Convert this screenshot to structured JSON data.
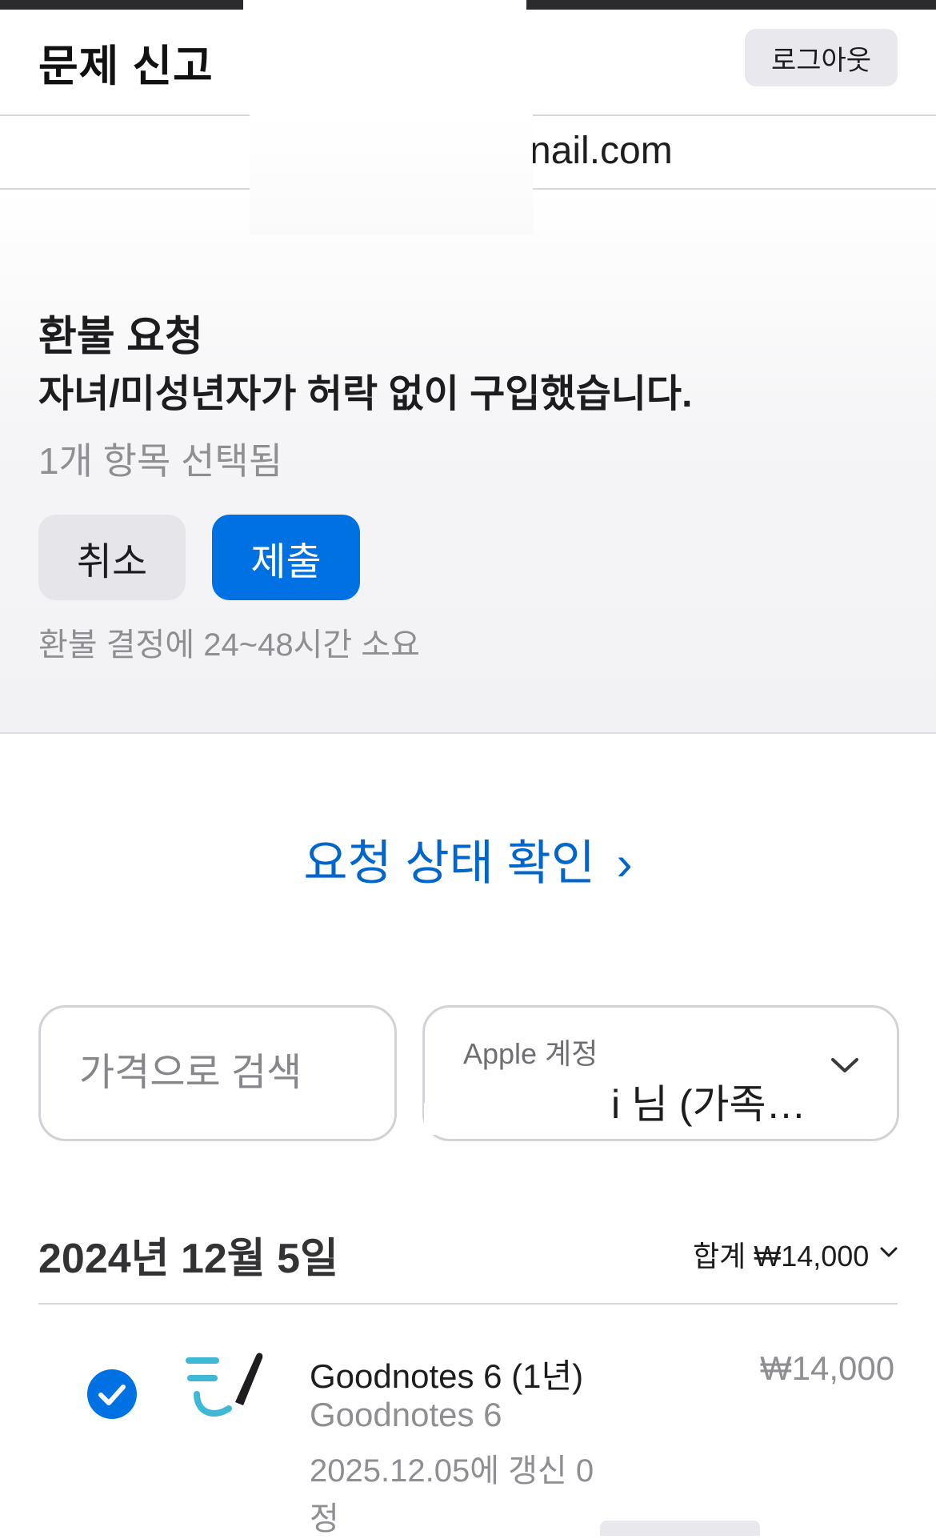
{
  "header": {
    "title": "문제 신고",
    "logout_label": "로그아웃",
    "email_partial": "nail.com"
  },
  "refund": {
    "title": "환불 요청",
    "reason": "자녀/미성년자가 허락 없이 구입했습니다.",
    "selected_count": "1개 항목 선택됨",
    "cancel_label": "취소",
    "submit_label": "제출",
    "note": "환불 결정에 24~48시간 소요"
  },
  "status_link": {
    "label": "요청 상태 확인",
    "chevron": "›"
  },
  "filters": {
    "search_placeholder": "가격으로 검색",
    "account_label": "Apple 계정",
    "account_value": "i 님 (가족…"
  },
  "purchases": [
    {
      "date": "2024년 12월 5일",
      "total": "합계 ₩14,000",
      "items": [
        {
          "name": "Goodnotes 6 (1년)",
          "app": "Goodnotes 6",
          "renewal": "2025.12.05에 갱신 0",
          "renewal_cont": "정",
          "price": "₩14,000",
          "selected": true,
          "icon": "goodnotes-app-icon"
        }
      ]
    }
  ],
  "colors": {
    "accent": "#0071e3",
    "link": "#0066cc",
    "secondary_text": "#8e8e93"
  }
}
